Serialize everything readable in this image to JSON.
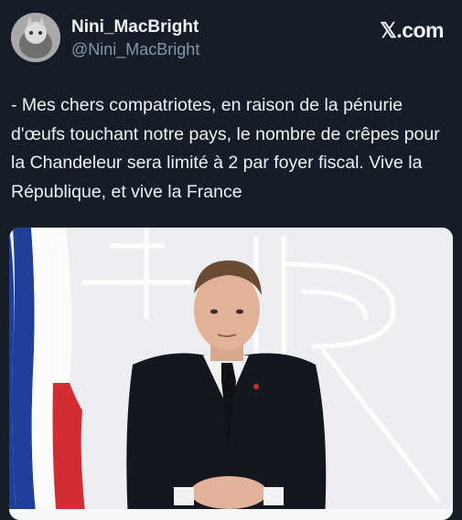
{
  "tweet": {
    "display_name": "Nini_MacBright",
    "handle": "@Nini_MacBright",
    "brand": "𝕏.com",
    "text": "- Mes chers compatriotes, en raison de la pénurie d'œufs touchant notre pays, le nombre de crêpes pour la Chandeleur sera limité à 2 par foyer fiscal. Vive la République, et vive la France"
  },
  "media": {
    "flag_colors": [
      "#1f3f9a",
      "#ffffff",
      "#d22e31"
    ],
    "suit_color": "#14171f",
    "background_color": "#eceef1"
  }
}
